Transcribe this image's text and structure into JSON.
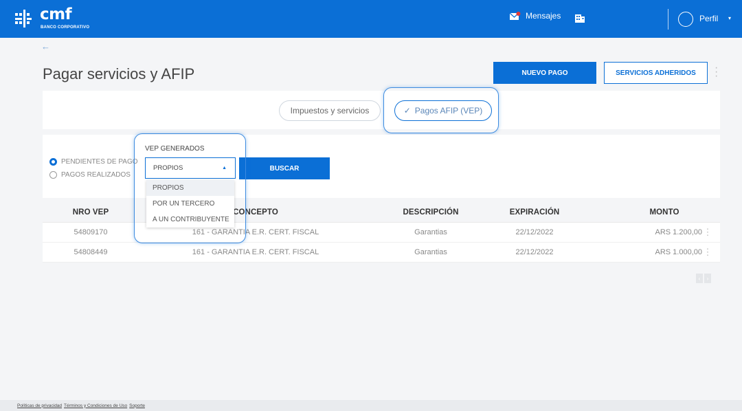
{
  "header": {
    "brand": "cmf",
    "brand_sub": "BANCO CORPORATIVO",
    "messages_label": "Mensajes",
    "profile_label": "Perfil",
    "caret": "▾"
  },
  "page": {
    "back_glyph": "←",
    "title": "Pagar servicios y AFIP",
    "new_payment_label": "NUEVO PAGO",
    "services_label": "SERVICIOS ADHERIDOS"
  },
  "tabs": [
    {
      "label": "Impuestos y servicios"
    },
    {
      "label": "Pagos AFIP (VEP)",
      "check": "✓"
    }
  ],
  "filters": {
    "radio_pending": "PENDIENTES DE PAGO",
    "radio_done": "PAGOS REALIZADOS",
    "select_label": "VEP GENERADOS",
    "select_value": "PROPIOS",
    "select_caret": "▲",
    "options": [
      "PROPIOS",
      "POR UN TERCERO",
      "A UN CONTRIBUYENTE"
    ],
    "search_label": "BUSCAR"
  },
  "table": {
    "headers": [
      "NRO VEP",
      "CONCEPTO",
      "DESCRIPCIÓN",
      "EXPIRACIÓN",
      "MONTO"
    ],
    "rows": [
      [
        "54809170",
        "161 - GARANTIA E.R. CERT. FISCAL",
        "Garantias",
        "22/12/2022",
        "ARS 1.200,00"
      ],
      [
        "54808449",
        "161 - GARANTIA E.R. CERT. FISCAL",
        "Garantias",
        "22/12/2022",
        "ARS 1.000,00"
      ]
    ]
  },
  "pager": {
    "prev": "‹",
    "next": "›"
  },
  "footer": {
    "links": [
      "Políticas de privacidad",
      "Términos y Condiciones de Uso",
      "Soporte"
    ]
  },
  "colors": {
    "brand": "#0b6fd6",
    "highlight": "#3d8be0"
  },
  "icons": [
    "logo-icon",
    "envelope-icon",
    "building-icon",
    "avatar-icon",
    "kebab-icon",
    "check-icon",
    "chevron-up-icon"
  ]
}
